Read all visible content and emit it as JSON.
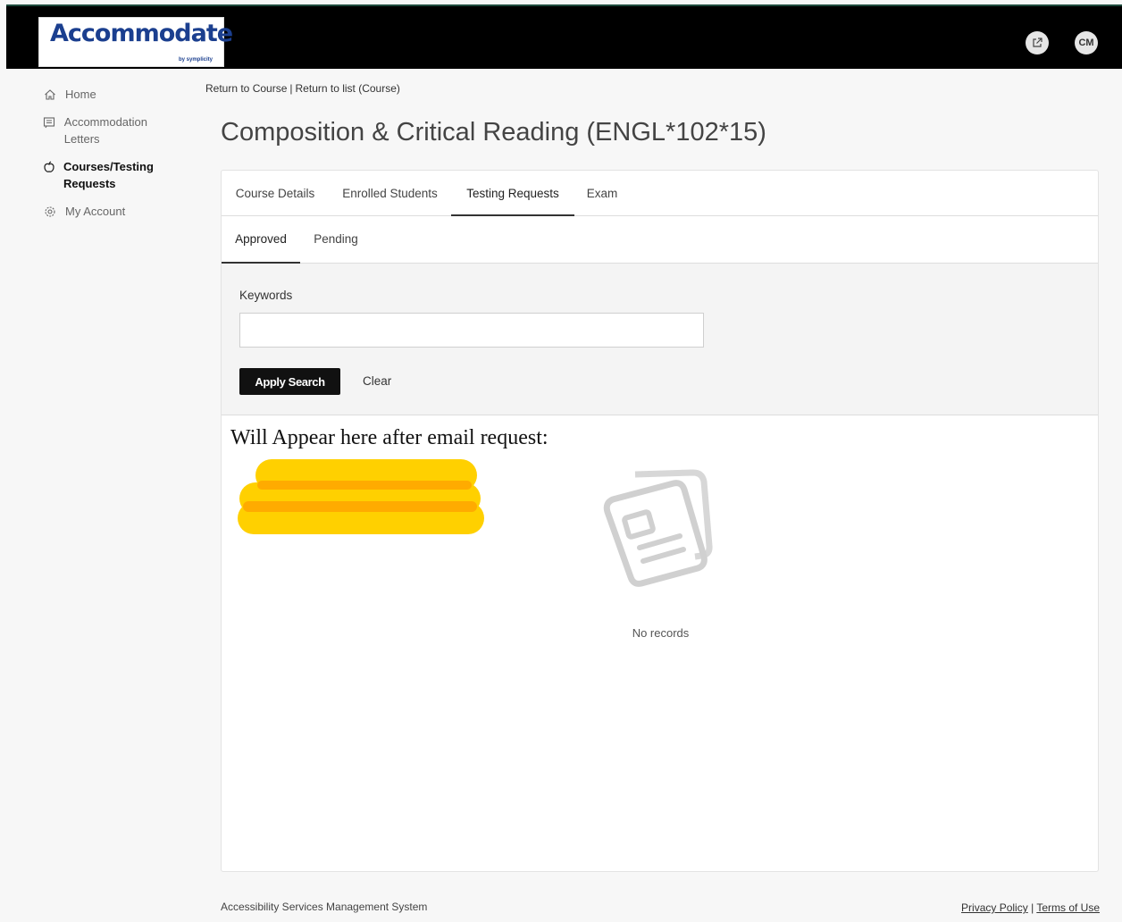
{
  "header": {
    "logo_text": "Accommodate",
    "logo_byline": "by symplicity",
    "avatar_initials": "CM"
  },
  "sidebar": {
    "items": [
      {
        "label": "Home",
        "icon": "home-icon"
      },
      {
        "label": "Accommodation Letters",
        "icon": "letter-icon"
      },
      {
        "label": "Courses/Testing Requests",
        "icon": "apple-icon",
        "active": true
      },
      {
        "label": "My Account",
        "icon": "gear-icon"
      }
    ]
  },
  "breadcrumb": {
    "return_course": "Return to Course",
    "separator": "|",
    "return_list": "Return to list (Course)"
  },
  "page_title": "Composition & Critical Reading (ENGL*102*15)",
  "tabs": [
    {
      "label": "Course Details"
    },
    {
      "label": "Enrolled Students"
    },
    {
      "label": "Testing Requests",
      "active": true
    },
    {
      "label": "Exam"
    }
  ],
  "subtabs": [
    {
      "label": "Approved",
      "active": true
    },
    {
      "label": "Pending"
    }
  ],
  "search": {
    "keywords_label": "Keywords",
    "keywords_value": "",
    "keywords_placeholder": "",
    "apply_label": "Apply Search",
    "clear_label": "Clear"
  },
  "annotation": {
    "text": "Will Appear here after email request:",
    "highlight_color": "#ffd000"
  },
  "empty_state": {
    "text": "No records"
  },
  "footer": {
    "system_name": "Accessibility Services Management System",
    "privacy": "Privacy Policy",
    "separator": "|",
    "terms": "Terms of Use"
  }
}
